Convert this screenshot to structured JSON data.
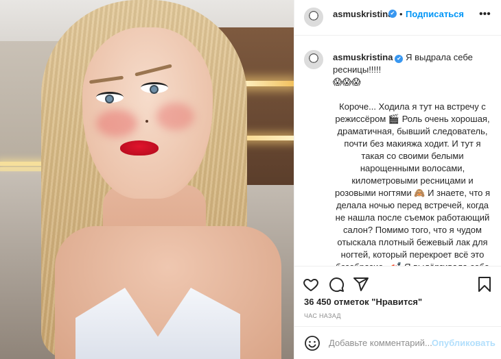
{
  "post": {
    "username": "asmuskristina",
    "follow_label": "Подписаться",
    "separator": "•",
    "more_icon": "more-dots-icon",
    "verified_icon": "✔",
    "caption_title": "Я выдрала себе ресницы!!!!!",
    "caption_emoji": "😱😱😱",
    "caption_body": "Короче... Ходила я тут на встречу с режиссёром 🎬 Роль очень хорошая, драматичная, бывший следователь, почти без макияжа ходит. И тут я такая со своими белыми нарощенными волосами, километровыми ресницами и розовыми ногтями 🙈 И знаете, что я делала ночью перед встречей, когда не нашла после съемок работающий салон? Помимо того, что я чудом отыскала плотный бежевый лак для ногтей, который перекроет всё это безобразие.. 💅 Я выдёргивала себе нарощенные ресницы. Некоторые со своими",
    "likes": "36 450 отметок \"Нравится\"",
    "time": "час назад"
  },
  "comment": {
    "placeholder": "Добавьте комментарий...",
    "publish_label": "Опубликовать"
  },
  "colors": {
    "link_blue": "#0095f6",
    "verified_blue": "#3897f0",
    "publish_disabled": "#b2dffc",
    "border": "#efefef"
  }
}
